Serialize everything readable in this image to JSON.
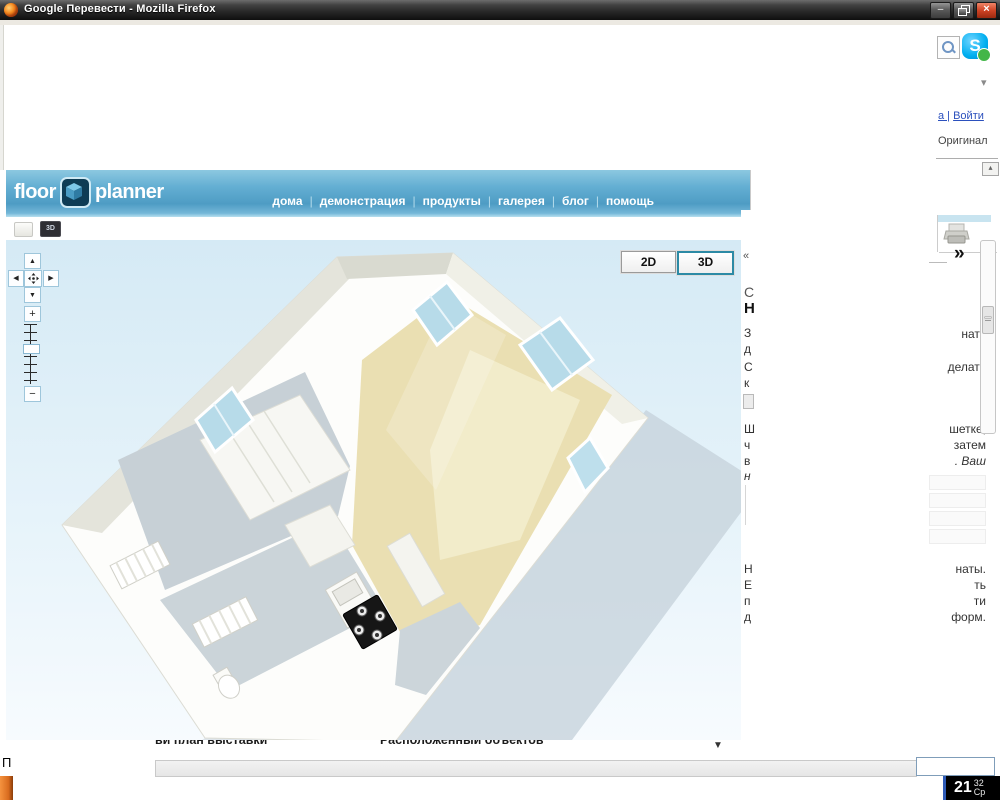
{
  "titlebar": {
    "title": "Google Перевести - Mozilla Firefox",
    "min_glyph": "–",
    "close_glyph": "×"
  },
  "chrome": {
    "reg_fragment": "а |",
    "login": "Войти",
    "original": "Оригинал",
    "dropdown_glyph": "▾",
    "collapse_glyph": "▴",
    "skype_glyph": "S"
  },
  "floorplanner": {
    "logo_left": "floor",
    "logo_right": "planner",
    "nav_sep": "|",
    "nav": [
      "дома",
      "демонстрация",
      "продукты",
      "галерея",
      "блог",
      "помощь"
    ],
    "btn_2d": "2D",
    "btn_3d": "3D",
    "pan_up": "▲",
    "pan_left": "◀",
    "pan_right": "▶",
    "pan_down": "▼",
    "zoom_in": "+",
    "zoom_out": "−",
    "tab_left": "ви план выставки",
    "tab_right": "Расположенный объектов",
    "tab_caret": "▼"
  },
  "right_panel": {
    "collapse_left": "«",
    "collapse_right": "»",
    "left": [
      "С",
      "Н",
      "З",
      "д",
      "С",
      "к",
      "Ш",
      "ч",
      "в",
      "н",
      "Н",
      "Е",
      "п",
      "д"
    ],
    "right": [
      "нату",
      "делать",
      "шетке,",
      "затем",
      ". Ваш",
      "наты.",
      "ть",
      "ти",
      "форм."
    ]
  },
  "statusbar": {
    "fragment": "П"
  },
  "clock": {
    "hours": "21",
    "minutes": "32",
    "day": "Ср"
  },
  "colors": {
    "header_blue": "#4e9cc4",
    "accent_teal": "#2c8aa5",
    "link_blue": "#2b50bd"
  }
}
